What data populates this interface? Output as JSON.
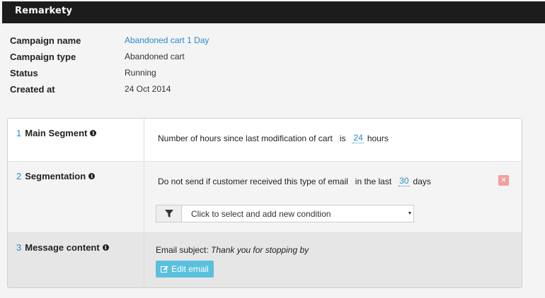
{
  "header": {
    "logo": "Remarkety"
  },
  "campaign": {
    "name_label": "Campaign name",
    "name_value": "Abandoned cart 1 Day",
    "type_label": "Campaign type",
    "type_value": "Abandoned cart",
    "status_label": "Status",
    "status_value": "Running",
    "created_label": "Created at",
    "created_value": "24 Oct 2014"
  },
  "steps": [
    {
      "number": "1",
      "title": "Main Segment",
      "condition": {
        "text": "Number of hours since last modification of cart",
        "operator": "is",
        "value": "24",
        "unit": "hours"
      }
    },
    {
      "number": "2",
      "title": "Segmentation",
      "condition": {
        "text": "Do not send if customer received this type of email",
        "operator": "in the last",
        "value": "30",
        "unit": "days"
      },
      "remove_icon": "close-icon",
      "select_placeholder": "Click to select and add new condition"
    },
    {
      "number": "3",
      "title": "Message content",
      "subject_label": "Email subject:",
      "subject_value": "Thank you for stopping by",
      "edit_button": "Edit email"
    }
  ],
  "colors": {
    "accent": "#2a8ac8",
    "button": "#5bc0de",
    "remove": "#f0a0a0",
    "topbar": "#1c1c1c"
  }
}
